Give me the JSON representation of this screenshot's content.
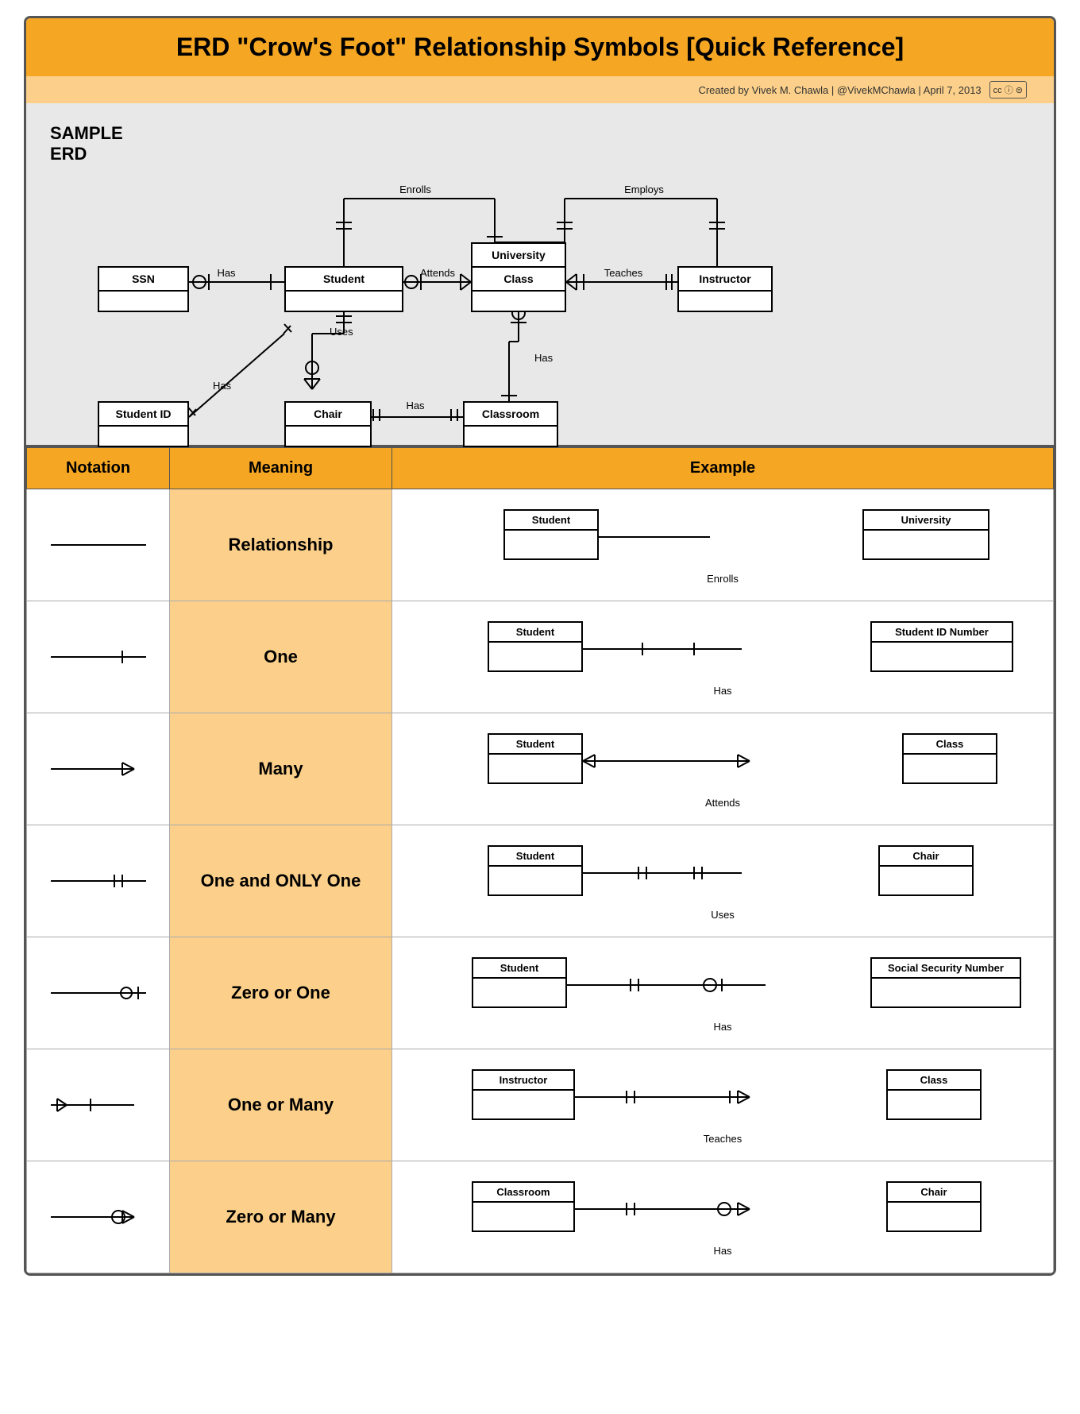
{
  "title": "ERD \"Crow's Foot\" Relationship Symbols [Quick Reference]",
  "subtitle": "Created by Vivek M. Chawla  |  @VivekMChawla  |  April 7, 2013",
  "erd_label": "SAMPLE\nERD",
  "table_headers": {
    "notation": "Notation",
    "meaning": "Meaning",
    "example": "Example"
  },
  "rows": [
    {
      "notation": "relationship",
      "meaning": "Relationship",
      "example_left": "Student",
      "example_right": "University",
      "example_label": "Enrolls"
    },
    {
      "notation": "one",
      "meaning": "One",
      "example_left": "Student",
      "example_right": "Student ID Number",
      "example_label": "Has"
    },
    {
      "notation": "many",
      "meaning": "Many",
      "example_left": "Student",
      "example_right": "Class",
      "example_label": "Attends"
    },
    {
      "notation": "one_only",
      "meaning": "One and ONLY One",
      "example_left": "Student",
      "example_right": "Chair",
      "example_label": "Uses"
    },
    {
      "notation": "zero_or_one",
      "meaning": "Zero or One",
      "example_left": "Student",
      "example_right": "Social Security Number",
      "example_label": "Has"
    },
    {
      "notation": "one_or_many",
      "meaning": "One or Many",
      "example_left": "Instructor",
      "example_right": "Class",
      "example_label": "Teaches"
    },
    {
      "notation": "zero_or_many",
      "meaning": "Zero or Many",
      "example_left": "Classroom",
      "example_right": "Chair",
      "example_label": "Has"
    }
  ]
}
